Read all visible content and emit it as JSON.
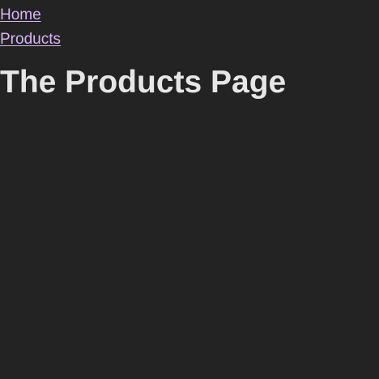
{
  "nav": {
    "links": [
      {
        "label": "Home"
      },
      {
        "label": "Products"
      }
    ]
  },
  "page": {
    "title": "The Products Page"
  },
  "colors": {
    "background": "#232323",
    "link": "#d7b5f3",
    "text": "#e6e6e6"
  }
}
